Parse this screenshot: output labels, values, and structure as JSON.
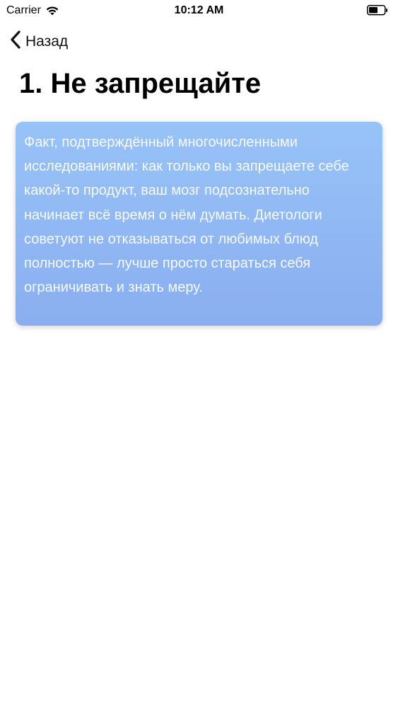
{
  "status_bar": {
    "carrier": "Carrier",
    "time": "10:12 AM",
    "icons": [
      "wifi-icon",
      "battery-icon"
    ]
  },
  "nav": {
    "back_label": "Назад",
    "back_icon": "chevron-left-icon"
  },
  "page": {
    "title": "1. Не запрещайте"
  },
  "card": {
    "text": "Факт, подтверждённый многочисленными исследованиями: как только вы запрещаете себе какой-то продукт, ваш мозг подсознательно начинает всё время о нём думать. Диетологи советуют не отказываться от любимых блюд полностью — лучше просто стараться себя ограничивать и знать меру.",
    "gradient_top": "#97c3f8",
    "gradient_bottom": "#8aaeef",
    "text_color": "#f7faff"
  }
}
